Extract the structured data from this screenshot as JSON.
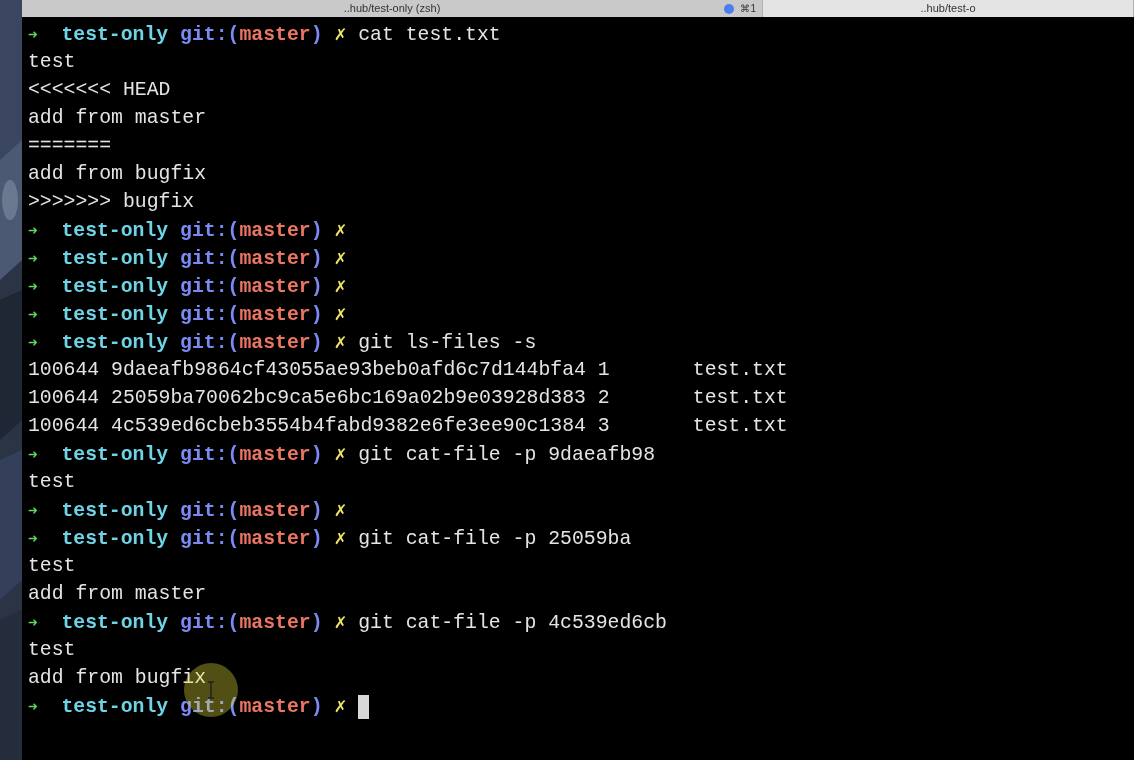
{
  "tabs": [
    {
      "title": "..hub/test-only (zsh)",
      "shortcut": "⌘1",
      "selected": true
    },
    {
      "title": "..hub/test-o",
      "selected": false
    }
  ],
  "lines": [
    {
      "kind": "prompt",
      "arrow": "➜",
      "dir": "test-only",
      "git_open": "git:(",
      "branch": "master",
      "git_close": ")",
      "dirty": "✗",
      "command": "cat test.txt"
    },
    {
      "kind": "output",
      "text": "test"
    },
    {
      "kind": "output",
      "text": "<<<<<<< HEAD"
    },
    {
      "kind": "output",
      "text": "add from master"
    },
    {
      "kind": "output",
      "text": "======="
    },
    {
      "kind": "output",
      "text": "add from bugfix"
    },
    {
      "kind": "output",
      "text": ">>>>>>> bugfix"
    },
    {
      "kind": "prompt",
      "arrow": "➜",
      "dir": "test-only",
      "git_open": "git:(",
      "branch": "master",
      "git_close": ")",
      "dirty": "✗"
    },
    {
      "kind": "prompt",
      "arrow": "➜",
      "dir": "test-only",
      "git_open": "git:(",
      "branch": "master",
      "git_close": ")",
      "dirty": "✗"
    },
    {
      "kind": "prompt",
      "arrow": "➜",
      "dir": "test-only",
      "git_open": "git:(",
      "branch": "master",
      "git_close": ")",
      "dirty": "✗"
    },
    {
      "kind": "prompt",
      "arrow": "➜",
      "dir": "test-only",
      "git_open": "git:(",
      "branch": "master",
      "git_close": ")",
      "dirty": "✗"
    },
    {
      "kind": "prompt",
      "arrow": "➜",
      "dir": "test-only",
      "git_open": "git:(",
      "branch": "master",
      "git_close": ")",
      "dirty": "✗",
      "command": "git ls-files -s"
    },
    {
      "kind": "output",
      "text": "100644 9daeafb9864cf43055ae93beb0afd6c7d144bfa4 1       test.txt"
    },
    {
      "kind": "output",
      "text": "100644 25059ba70062bc9ca5e6bc169a02b9e03928d383 2       test.txt"
    },
    {
      "kind": "output",
      "text": "100644 4c539ed6cbeb3554b4fabd9382e6fe3ee90c1384 3       test.txt"
    },
    {
      "kind": "prompt",
      "arrow": "➜",
      "dir": "test-only",
      "git_open": "git:(",
      "branch": "master",
      "git_close": ")",
      "dirty": "✗",
      "command": "git cat-file -p 9daeafb98"
    },
    {
      "kind": "output",
      "text": "test"
    },
    {
      "kind": "prompt",
      "arrow": "➜",
      "dir": "test-only",
      "git_open": "git:(",
      "branch": "master",
      "git_close": ")",
      "dirty": "✗"
    },
    {
      "kind": "prompt",
      "arrow": "➜",
      "dir": "test-only",
      "git_open": "git:(",
      "branch": "master",
      "git_close": ")",
      "dirty": "✗",
      "command": "git cat-file -p 25059ba"
    },
    {
      "kind": "output",
      "text": "test"
    },
    {
      "kind": "output",
      "text": "add from master"
    },
    {
      "kind": "prompt",
      "arrow": "➜",
      "dir": "test-only",
      "git_open": "git:(",
      "branch": "master",
      "git_close": ")",
      "dirty": "✗",
      "command": "git cat-file -p 4c539ed6cb"
    },
    {
      "kind": "output",
      "text": "test"
    },
    {
      "kind": "output",
      "text": "add from bugfix"
    },
    {
      "kind": "prompt",
      "arrow": "➜",
      "dir": "test-only",
      "git_open": "git:(",
      "branch": "master",
      "git_close": ")",
      "dirty": "✗"
    }
  ]
}
